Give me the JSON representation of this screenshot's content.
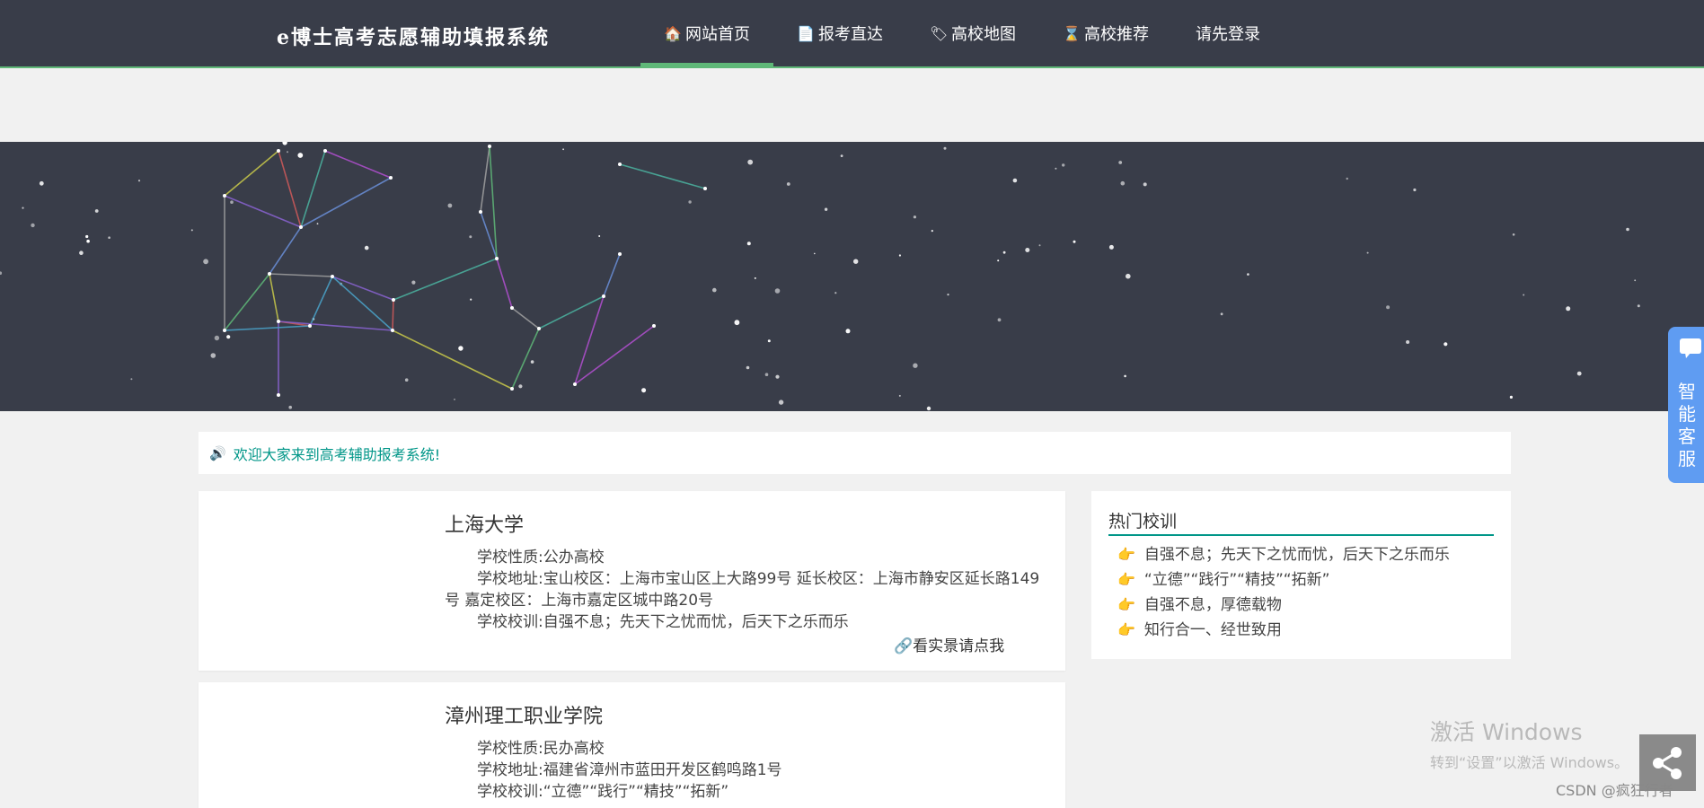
{
  "header": {
    "brand": "e博士高考志愿辅助填报系统",
    "nav": [
      {
        "icon": "home-icon",
        "glyph": "🏠",
        "label": "网站首页",
        "active": true
      },
      {
        "icon": "file-icon",
        "glyph": "📄",
        "label": "报考直达"
      },
      {
        "icon": "tags-icon",
        "glyph": "🏷",
        "label": "高校地图"
      },
      {
        "icon": "hourglass-icon",
        "glyph": "⌛",
        "label": "高校推荐"
      },
      {
        "icon": "",
        "glyph": "",
        "label": "请先登录"
      }
    ]
  },
  "notice": {
    "icon": "volume-icon",
    "text": "欢迎大家来到高考辅助报考系统!"
  },
  "colleges": [
    {
      "name": "上海大学",
      "nature": "学校性质:公办高校",
      "address": "学校地址:宝山校区：上海市宝山区上大路99号 延长校区：上海市静安区延长路149号 嘉定校区：上海市嘉定区城中路20号",
      "motto": "学校校训:自强不息；先天下之忧而忧，后天下之乐而乐",
      "link": "看实景请点我"
    },
    {
      "name": "漳州理工职业学院",
      "nature": "学校性质:民办高校",
      "address": "学校地址:福建省漳州市蓝田开发区鹤鸣路1号",
      "motto": "学校校训:“立德”“践行”“精技”“拓新”"
    }
  ],
  "sidebar": {
    "title": "热门校训",
    "mottos": [
      "自强不息；先天下之忧而忧，后天下之乐而乐",
      "“立德”“践行”“精技”“拓新”",
      "自强不息，厚德载物",
      "知行合一、经世致用"
    ]
  },
  "customer_service": {
    "label": "智能客服"
  },
  "watermark": {
    "line1": "激活 Windows",
    "line2": "转到“设置”以激活 Windows。"
  },
  "csdn": "CSDN @疯狂行者",
  "colors": {
    "header_bg": "#393d49",
    "accent": "#5fb878",
    "teal": "#009688",
    "cs_blue": "#5f9cf2"
  }
}
